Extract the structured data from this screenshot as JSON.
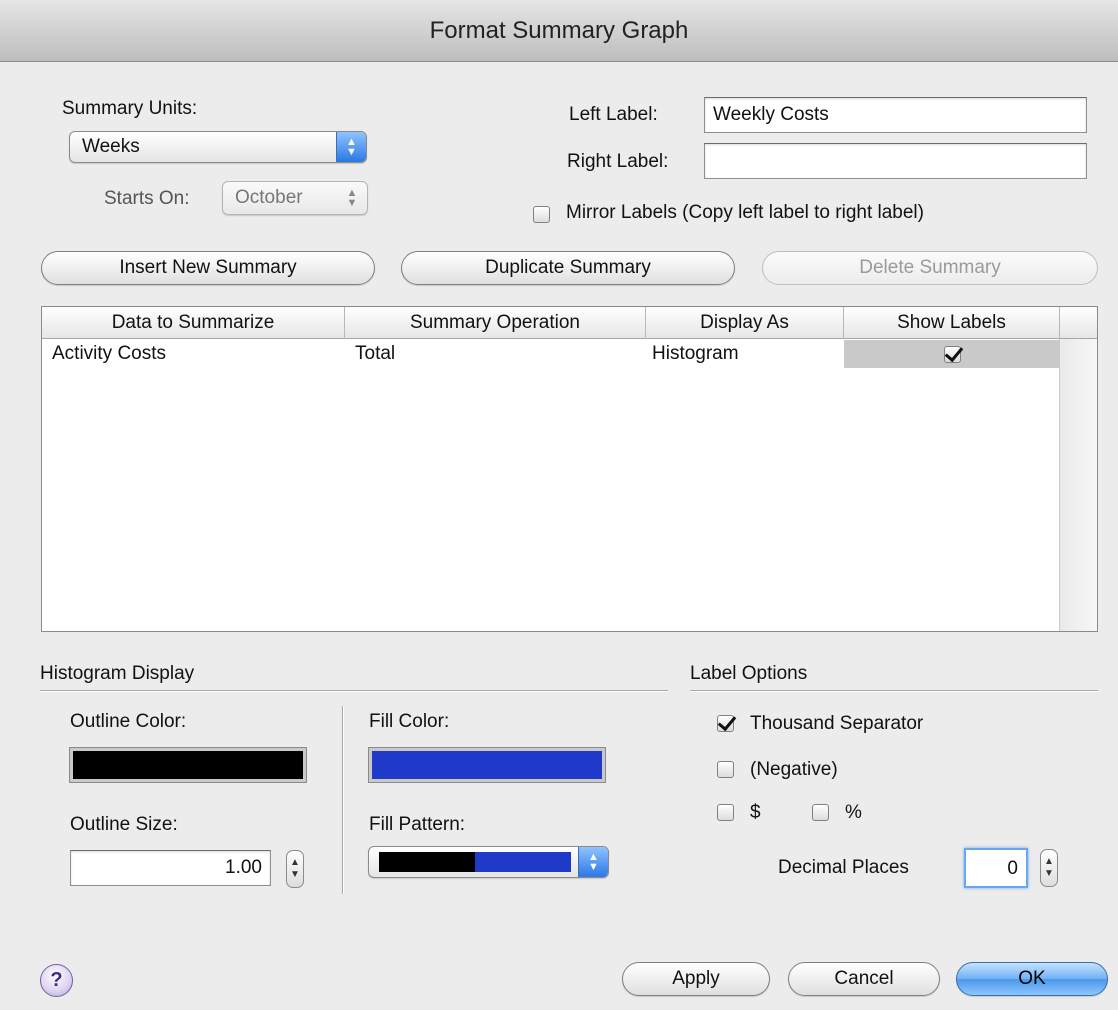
{
  "window": {
    "title": "Format Summary Graph"
  },
  "summary_units": {
    "label": "Summary Units:",
    "value": "Weeks"
  },
  "starts_on": {
    "label": "Starts On:",
    "value": "October"
  },
  "left_label": {
    "label": "Left Label:",
    "value": "Weekly Costs"
  },
  "right_label": {
    "label": "Right Label:",
    "value": ""
  },
  "mirror_labels": {
    "label": "Mirror Labels (Copy left label to right label)",
    "checked": false
  },
  "buttons": {
    "insert": "Insert New Summary",
    "duplicate": "Duplicate Summary",
    "delete": "Delete Summary",
    "apply": "Apply",
    "cancel": "Cancel",
    "ok": "OK",
    "help": "?"
  },
  "table": {
    "columns": [
      "Data to Summarize",
      "Summary Operation",
      "Display As",
      "Show Labels"
    ],
    "rows": [
      {
        "data": "Activity Costs",
        "operation": "Total",
        "display_as": "Histogram",
        "show_labels": true
      }
    ]
  },
  "histogram": {
    "title": "Histogram Display",
    "outline_color_label": "Outline Color:",
    "outline_color": "#000000",
    "outline_size_label": "Outline Size:",
    "outline_size": "1.00",
    "fill_color_label": "Fill Color:",
    "fill_color": "#1f39c8",
    "fill_pattern_label": "Fill Pattern:"
  },
  "label_options": {
    "title": "Label Options",
    "thousand_separator": {
      "label": "Thousand Separator",
      "checked": true
    },
    "negative": {
      "label": "(Negative)",
      "checked": false
    },
    "dollar": {
      "label": "$",
      "checked": false
    },
    "percent": {
      "label": "%",
      "checked": false
    },
    "decimal_places_label": "Decimal Places",
    "decimal_places": "0"
  }
}
